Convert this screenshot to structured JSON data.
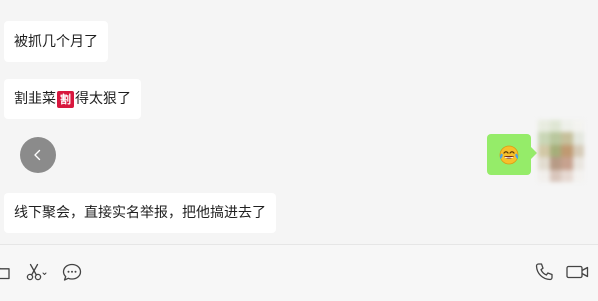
{
  "messages": [
    {
      "text": "被抓几个月了"
    },
    {
      "text_before": "割韭菜",
      "badge": "割",
      "text_after": "得太狠了"
    },
    {
      "text": "线下聚会，直接实名举报，把他搞进去了"
    }
  ],
  "sent_message": {
    "emoji": "😂"
  },
  "toolbar": {
    "left_icons": [
      "folder-icon",
      "scissors-icon",
      "chat-bubble-icon"
    ],
    "right_icons": [
      "phone-icon",
      "video-icon"
    ]
  },
  "colors": {
    "background": "#f5f5f5",
    "incoming_bubble": "#ffffff",
    "outgoing_bubble": "#95ec69",
    "badge": "#d8173e",
    "back_button": "#8b8b8b",
    "icon": "#444444"
  }
}
